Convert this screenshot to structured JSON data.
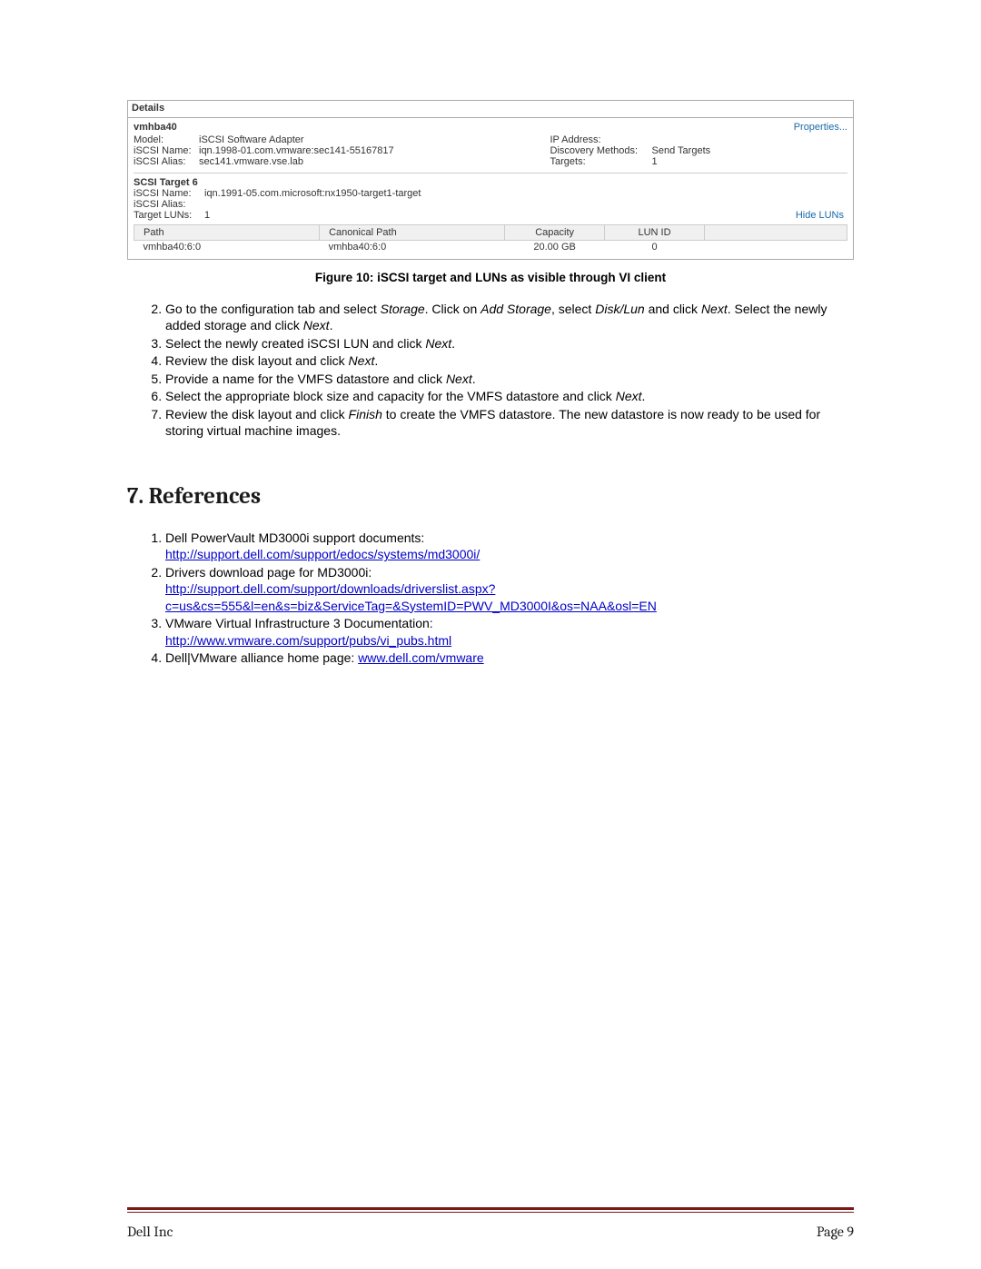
{
  "details": {
    "title": "Details",
    "adapter": "vmhba40",
    "properties_link": "Properties...",
    "left": {
      "model_label": "Model:",
      "model_value": "iSCSI Software Adapter",
      "iscsi_name_label": "iSCSI Name:",
      "iscsi_name_value": "iqn.1998-01.com.vmware:sec141-55167817",
      "iscsi_alias_label": "iSCSI Alias:",
      "iscsi_alias_value": "sec141.vmware.vse.lab"
    },
    "right": {
      "ip_label": "IP Address:",
      "ip_value": "",
      "discovery_label": "Discovery Methods:",
      "discovery_value": "Send Targets",
      "targets_label": "Targets:",
      "targets_value": "1"
    },
    "target_section": "SCSI Target 6",
    "target": {
      "name_label": "iSCSI Name:",
      "name_value": "iqn.1991-05.com.microsoft:nx1950-target1-target",
      "alias_label": "iSCSI Alias:",
      "alias_value": "",
      "luns_label": "Target LUNs:",
      "luns_value": "1"
    },
    "hide_luns": "Hide LUNs",
    "table": {
      "headers": {
        "path": "Path",
        "canonical": "Canonical Path",
        "capacity": "Capacity",
        "lun_id": "LUN ID"
      },
      "row": {
        "path": "vmhba40:6:0",
        "canonical": "vmhba40:6:0",
        "capacity": "20.00 GB",
        "lun_id": "0"
      }
    }
  },
  "figure_caption": "Figure 10: iSCSI target and LUNs as visible through VI client",
  "steps": {
    "s2a": "Go to the configuration tab and select ",
    "s2_storage": "Storage",
    "s2b": ". Click on ",
    "s2_add": "Add Storage",
    "s2c": ", select ",
    "s2_disklun": "Disk/Lun",
    "s2d": " and click ",
    "s2_next1": "Next",
    "s2e": ". Select the newly added storage and click ",
    "s2_next2": "Next",
    "s2f": ".",
    "s3a": "Select the newly created iSCSI LUN and click ",
    "s3_next": "Next",
    "s3b": ".",
    "s4a": "Review the disk layout and click ",
    "s4_next": "Next",
    "s4b": ".",
    "s5a": "Provide a name for the VMFS datastore and click ",
    "s5_next": "Next",
    "s5b": ".",
    "s6a": "Select the appropriate block size and capacity for the VMFS datastore and click ",
    "s6_next": "Next",
    "s6b": ".",
    "s7a": "Review the disk layout and click ",
    "s7_finish": "Finish",
    "s7b": " to create the VMFS datastore. The new datastore is now ready to be used for storing virtual machine images."
  },
  "references_heading": "7.  References",
  "refs": {
    "r1_text": "Dell PowerVault MD3000i support documents:",
    "r1_link": "http://support.dell.com/support/edocs/systems/md3000i/",
    "r2_text": "Drivers download page for MD3000i:",
    "r2_link": "http://support.dell.com/support/downloads/driverslist.aspx?c=us&cs=555&l=en&s=biz&ServiceTag=&SystemID=PWV_MD3000I&os=NAA&osl=EN",
    "r3_text": "VMware Virtual Infrastructure 3 Documentation:",
    "r3_link": "http://www.vmware.com/support/pubs/vi_pubs.html",
    "r4_text": "Dell|VMware alliance home page: ",
    "r4_link": "www.dell.com/vmware"
  },
  "footer": {
    "left": "Dell Inc",
    "right": "Page 9"
  }
}
